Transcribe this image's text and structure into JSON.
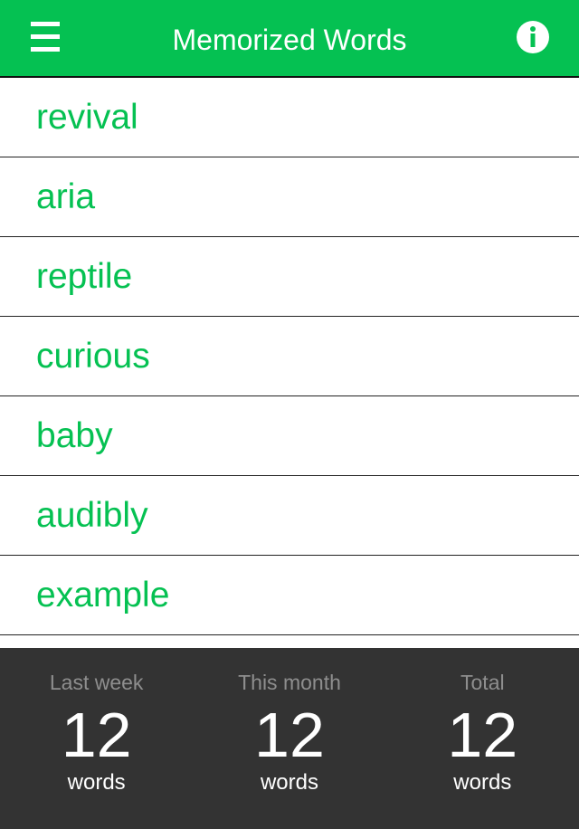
{
  "header": {
    "title": "Memorized Words",
    "menu_icon": "hamburger-menu-icon",
    "info_icon": "info-icon",
    "accent_color": "#05c152"
  },
  "words": [
    "revival",
    "aria",
    "reptile",
    "curious",
    "baby",
    "audibly",
    "example"
  ],
  "stats": [
    {
      "label": "Last week",
      "value": "12",
      "unit": "words"
    },
    {
      "label": "This month",
      "value": "12",
      "unit": "words"
    },
    {
      "label": "Total",
      "value": "12",
      "unit": "words"
    }
  ]
}
